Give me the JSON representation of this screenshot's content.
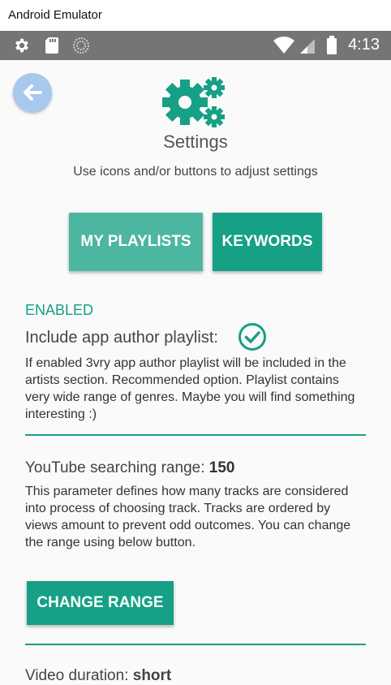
{
  "window": {
    "title": "Android Emulator"
  },
  "status_bar": {
    "time": "4:13",
    "icons": [
      "settings-icon",
      "sd-card-icon",
      "sync-icon",
      "wifi-icon",
      "signal-icon",
      "battery-icon"
    ]
  },
  "header": {
    "title": "Settings",
    "subtitle": "Use icons and/or buttons to adjust settings"
  },
  "buttons": {
    "my_playlists": "MY PLAYLISTS",
    "keywords": "KEYWORDS",
    "change_range": "CHANGE RANGE"
  },
  "author_playlist": {
    "status": "ENABLED",
    "label": "Include app author playlist:",
    "description": "If enabled 3vry app author playlist will be included in the artists section. Recommended option. Playlist contains very wide range of genres. Maybe you will find something interesting :)"
  },
  "search_range": {
    "label": "YouTube searching range: ",
    "value": "150",
    "description": "This parameter defines how many tracks are considered into process of choosing track. Tracks are ordered by views amount to prevent odd outcomes. You can change the range using below button."
  },
  "video_duration": {
    "label": "Video duration: ",
    "value": "short"
  },
  "colors": {
    "accent": "#16a085",
    "accent_light": "#4db6a0",
    "status_bar": "#757575",
    "back_button": "#a9c8ee"
  }
}
